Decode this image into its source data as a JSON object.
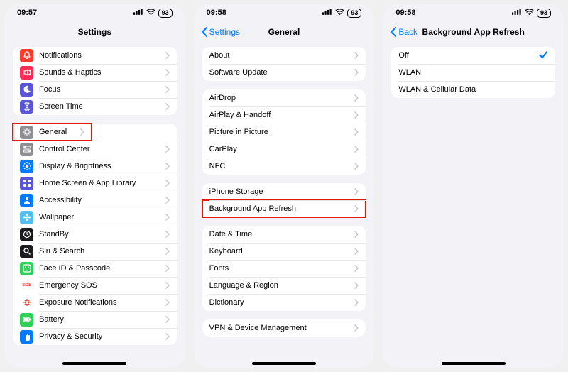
{
  "statusbar": {
    "battery": "93",
    "signal_icon": "signal",
    "wifi_icon": "wifi"
  },
  "screens": [
    {
      "time": "09:57",
      "title": "Settings",
      "back": null,
      "groups": [
        [
          {
            "icon": "bell",
            "bg": "#ff3b30",
            "label": "Notifications"
          },
          {
            "icon": "speaker",
            "bg": "#ff2d55",
            "label": "Sounds & Haptics"
          },
          {
            "icon": "moon",
            "bg": "#5856d6",
            "label": "Focus"
          },
          {
            "icon": "hourglass",
            "bg": "#5856d6",
            "label": "Screen Time"
          }
        ],
        [
          {
            "icon": "gear",
            "bg": "#8e8e93",
            "label": "General",
            "highlight": true,
            "highlight_wide": true
          },
          {
            "icon": "switches",
            "bg": "#8e8e93",
            "label": "Control Center"
          },
          {
            "icon": "sun",
            "bg": "#007aff",
            "label": "Display & Brightness"
          },
          {
            "icon": "grid",
            "bg": "#5955d8",
            "label": "Home Screen & App Library"
          },
          {
            "icon": "person",
            "bg": "#007aff",
            "label": "Accessibility"
          },
          {
            "icon": "flower",
            "bg": "#55bef0",
            "label": "Wallpaper"
          },
          {
            "icon": "clock",
            "bg": "#1c1c1e",
            "label": "StandBy"
          },
          {
            "icon": "search",
            "bg": "#1c1c1e",
            "label": "Siri & Search"
          },
          {
            "icon": "faceid",
            "bg": "#30d158",
            "label": "Face ID & Passcode"
          },
          {
            "icon": "sos",
            "bg": "#ffffff",
            "fg": "#ff3b30",
            "label": "Emergency SOS",
            "textIcon": "SOS"
          },
          {
            "icon": "virus",
            "bg": "#ffffff",
            "fg": "#ff3b30",
            "label": "Exposure Notifications"
          },
          {
            "icon": "battery",
            "bg": "#30d158",
            "label": "Battery"
          },
          {
            "icon": "hand",
            "bg": "#007aff",
            "label": "Privacy & Security"
          }
        ]
      ]
    },
    {
      "time": "09:58",
      "title": "General",
      "back": "Settings",
      "groups": [
        [
          {
            "label": "About"
          },
          {
            "label": "Software Update"
          }
        ],
        [
          {
            "label": "AirDrop"
          },
          {
            "label": "AirPlay & Handoff"
          },
          {
            "label": "Picture in Picture"
          },
          {
            "label": "CarPlay"
          },
          {
            "label": "NFC"
          }
        ],
        [
          {
            "label": "iPhone Storage"
          },
          {
            "label": "Background App Refresh",
            "highlight": true
          }
        ],
        [
          {
            "label": "Date & Time"
          },
          {
            "label": "Keyboard"
          },
          {
            "label": "Fonts"
          },
          {
            "label": "Language & Region"
          },
          {
            "label": "Dictionary"
          }
        ],
        [
          {
            "label": "VPN & Device Management"
          }
        ]
      ]
    },
    {
      "time": "09:58",
      "title": "Background App Refresh",
      "back": "Back",
      "groups": [
        [
          {
            "label": "Off",
            "selected": true,
            "nochev": true
          },
          {
            "label": "WLAN",
            "nochev": true
          },
          {
            "label": "WLAN & Cellular Data",
            "nochev": true
          }
        ]
      ]
    }
  ]
}
